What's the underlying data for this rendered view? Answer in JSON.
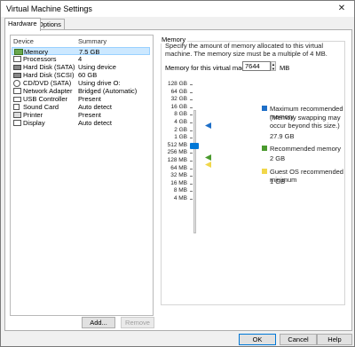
{
  "window": {
    "title": "Virtual Machine Settings",
    "close_glyph": "✕"
  },
  "tabs": [
    {
      "label": "Hardware"
    },
    {
      "label": "Options"
    }
  ],
  "device_list": {
    "col_device": "Device",
    "col_summary": "Summary",
    "rows": [
      {
        "name": "Memory",
        "summary": "7.5 GB",
        "icon": "memory-icon"
      },
      {
        "name": "Processors",
        "summary": "4",
        "icon": "processor-icon"
      },
      {
        "name": "Hard Disk (SATA)",
        "summary": "Using device",
        "icon": "hard-disk-icon"
      },
      {
        "name": "Hard Disk (SCSI)",
        "summary": "60 GB",
        "icon": "hard-disk-icon"
      },
      {
        "name": "CD/DVD (SATA)",
        "summary": "Using drive O:",
        "icon": "cd-dvd-icon"
      },
      {
        "name": "Network Adapter",
        "summary": "Bridged (Automatic)",
        "icon": "network-icon"
      },
      {
        "name": "USB Controller",
        "summary": "Present",
        "icon": "usb-icon"
      },
      {
        "name": "Sound Card",
        "summary": "Auto detect",
        "icon": "sound-icon"
      },
      {
        "name": "Printer",
        "summary": "Present",
        "icon": "printer-icon"
      },
      {
        "name": "Display",
        "summary": "Auto detect",
        "icon": "display-icon"
      }
    ],
    "add_label": "Add...",
    "remove_label": "Remove"
  },
  "memory": {
    "group_title": "Memory",
    "description": "Specify the amount of memory allocated to this virtual machine. The memory size must be a multiple of 4 MB.",
    "field_label": "Memory for this virtual machine:",
    "value": "7644",
    "unit": "MB",
    "scale_labels": [
      "128 GB",
      "64 GB",
      "32 GB",
      "16 GB",
      "8 GB",
      "4 GB",
      "2 GB",
      "1 GB",
      "512 MB",
      "256 MB",
      "128 MB",
      "64 MB",
      "32 MB",
      "16 MB",
      "8 MB",
      "4 MB"
    ],
    "legend": {
      "max_title": "Maximum recommended memory",
      "max_note": "(Memory swapping may occur beyond this size.)",
      "max_value": "27.9 GB",
      "rec_title": "Recommended memory",
      "rec_value": "2 GB",
      "guest_title": "Guest OS recommended minimum",
      "guest_value": "1 GB"
    },
    "colors": {
      "max": "#1e6fc8",
      "recommended": "#4a9a2e",
      "guest": "#f1d74a"
    }
  },
  "footer": {
    "ok_label": "OK",
    "cancel_label": "Cancel",
    "help_label": "Help"
  }
}
